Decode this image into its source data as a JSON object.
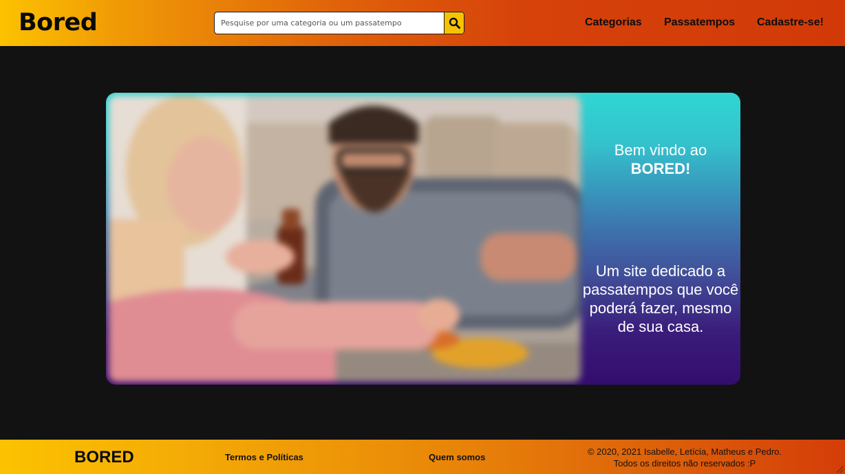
{
  "header": {
    "logo": "Bored",
    "search": {
      "placeholder": "Pesquise por uma categoria ou um passatempo",
      "value": ""
    },
    "search_button_icon": "search-icon",
    "nav": {
      "categorias": "Categorias",
      "passatempos": "Passatempos",
      "cadastre": "Cadastre-se!"
    }
  },
  "hero": {
    "image": "photo of two people assembling a jigsaw puzzle at a table",
    "welcome_line1": "Bem vindo ao",
    "welcome_brand": "BORED!",
    "description": "Um site dedicado a passatempos que você poderá fazer, mesmo de sua casa."
  },
  "footer": {
    "logo": "BORED",
    "termos": "Termos e Políticas",
    "quem_somos": "Quem somos",
    "copyright_line1": "© 2020, 2021 Isabelle, Letícia, Matheus e Pedro.",
    "copyright_line2": "Todos os direitos não reservados :P"
  },
  "colors": {
    "header_gradient_start": "#fcc200",
    "header_gradient_end": "#d13a08",
    "hero_gradient_top": "#2fd6d3",
    "hero_gradient_bottom": "#340d6e",
    "background": "#121212",
    "search_button": "#f6c300"
  }
}
